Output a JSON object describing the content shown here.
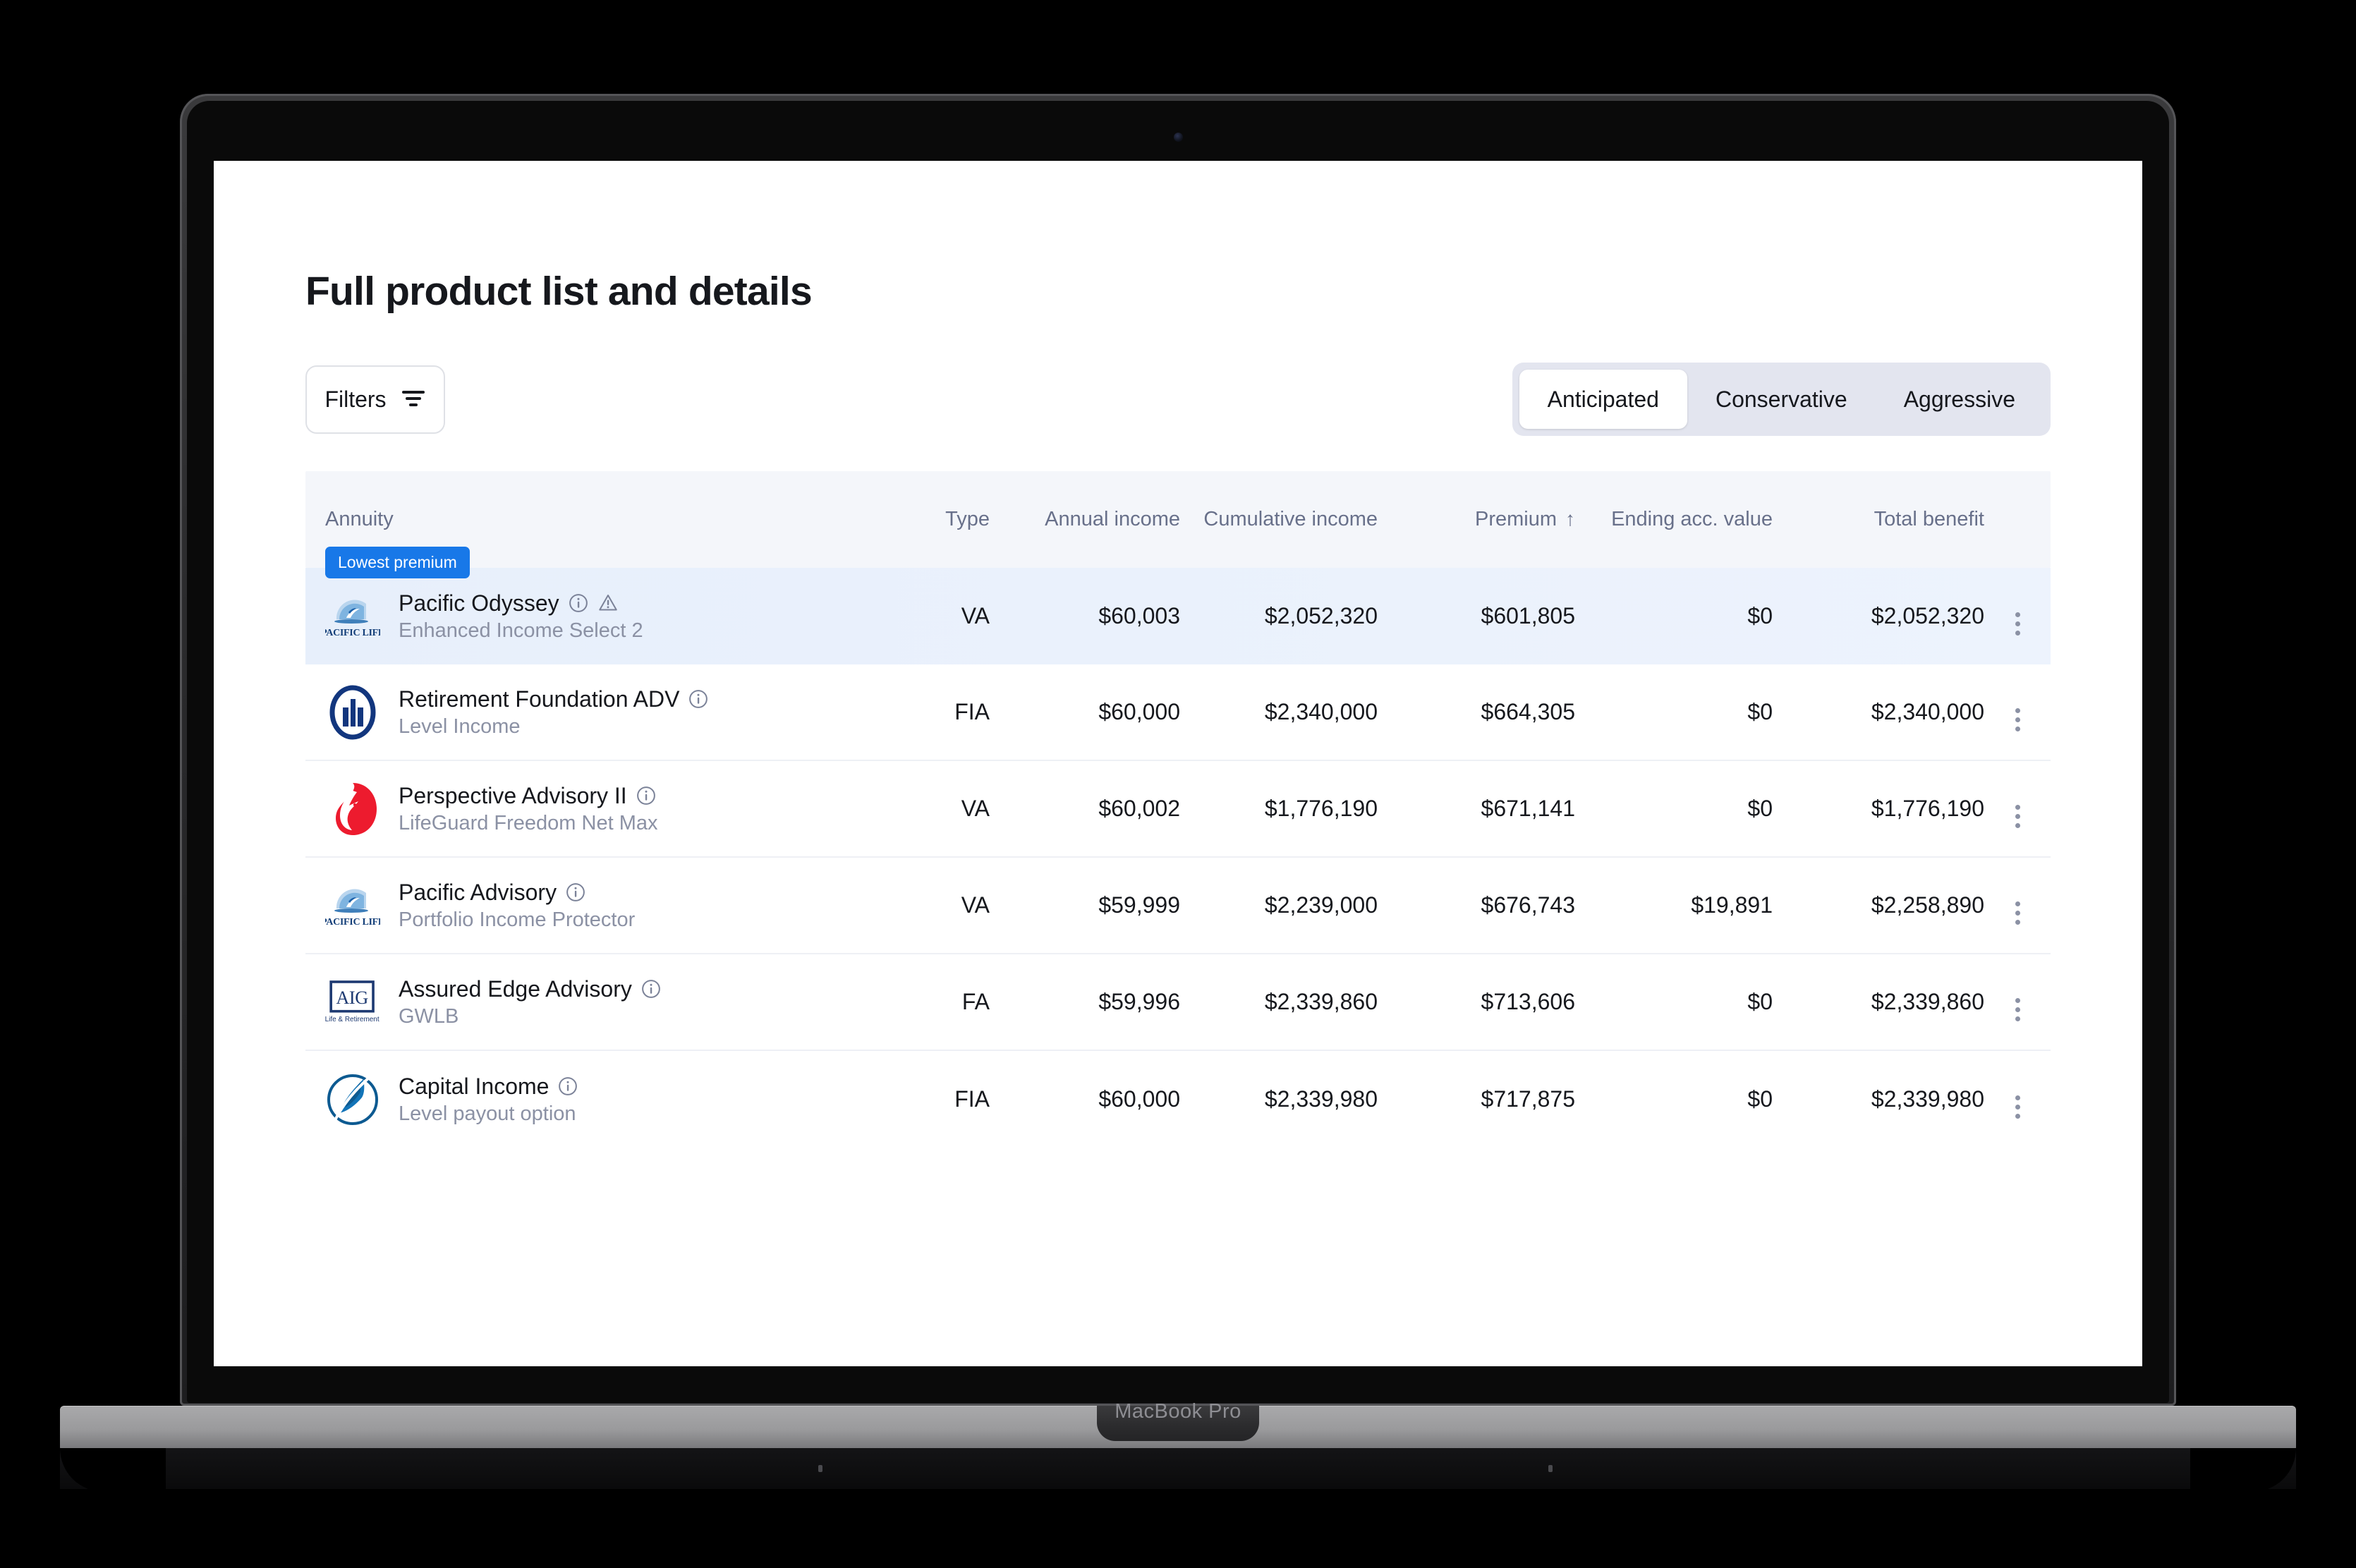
{
  "device": {
    "label": "MacBook Pro"
  },
  "page": {
    "title": "Full product list and details"
  },
  "toolbar": {
    "filters_label": "Filters",
    "filters_icon": "filter-icon",
    "scenarios": [
      {
        "label": "Anticipated",
        "active": true
      },
      {
        "label": "Conservative",
        "active": false
      },
      {
        "label": "Aggressive",
        "active": false
      }
    ]
  },
  "table": {
    "columns": [
      {
        "key": "annuity",
        "label": "Annuity"
      },
      {
        "key": "type",
        "label": "Type"
      },
      {
        "key": "annual_income",
        "label": "Annual income"
      },
      {
        "key": "cumulative_income",
        "label": "Cumulative income"
      },
      {
        "key": "premium",
        "label": "Premium",
        "sorted": true,
        "sort_dir": "asc",
        "sort_glyph": "↑"
      },
      {
        "key": "ending_acc_value",
        "label": "Ending acc. value"
      },
      {
        "key": "total_benefit",
        "label": "Total benefit"
      }
    ],
    "rows": [
      {
        "badge": "Lowest premium",
        "highlight": true,
        "logo": "pacific-life-logo",
        "name": "Pacific Odyssey",
        "subtitle": "Enhanced Income Select 2",
        "has_info": true,
        "has_warning": true,
        "type": "VA",
        "annual_income": "$60,003",
        "cumulative_income": "$2,052,320",
        "premium": "$601,805",
        "ending_acc_value": "$0",
        "total_benefit": "$2,052,320"
      },
      {
        "badge": null,
        "highlight": false,
        "logo": "allianz-logo",
        "name": "Retirement Foundation ADV",
        "subtitle": "Level Income",
        "has_info": true,
        "has_warning": false,
        "type": "FIA",
        "annual_income": "$60,000",
        "cumulative_income": "$2,340,000",
        "premium": "$664,305",
        "ending_acc_value": "$0",
        "total_benefit": "$2,340,000"
      },
      {
        "badge": null,
        "highlight": false,
        "logo": "prudential-logo",
        "name": "Perspective Advisory II",
        "subtitle": "LifeGuard Freedom Net Max",
        "has_info": true,
        "has_warning": false,
        "type": "VA",
        "annual_income": "$60,002",
        "cumulative_income": "$1,776,190",
        "premium": "$671,141",
        "ending_acc_value": "$0",
        "total_benefit": "$1,776,190"
      },
      {
        "badge": null,
        "highlight": false,
        "logo": "pacific-life-logo",
        "name": "Pacific Advisory",
        "subtitle": "Portfolio Income Protector",
        "has_info": true,
        "has_warning": false,
        "type": "VA",
        "annual_income": "$59,999",
        "cumulative_income": "$2,239,000",
        "premium": "$676,743",
        "ending_acc_value": "$19,891",
        "total_benefit": "$2,258,890"
      },
      {
        "badge": null,
        "highlight": false,
        "logo": "aig-logo",
        "name": "Assured Edge Advisory",
        "subtitle": "GWLB",
        "has_info": true,
        "has_warning": false,
        "type": "FA",
        "annual_income": "$59,996",
        "cumulative_income": "$2,339,860",
        "premium": "$713,606",
        "ending_acc_value": "$0",
        "total_benefit": "$2,339,860"
      },
      {
        "badge": null,
        "highlight": false,
        "logo": "nationwide-logo",
        "name": "Capital Income",
        "subtitle": "Level payout option",
        "has_info": true,
        "has_warning": false,
        "type": "FIA",
        "annual_income": "$60,000",
        "cumulative_income": "$2,339,980",
        "premium": "$717,875",
        "ending_acc_value": "$0",
        "total_benefit": "$2,339,980"
      }
    ]
  },
  "logos": {
    "pacific_life_text": "PACIFIC LIFE",
    "aig_text": "AIG",
    "aig_subtext": "Life & Retirement"
  },
  "colors": {
    "badge_blue": "#1878e8",
    "header_bg": "#f4f6fa",
    "header_text": "#68708a",
    "row_highlight": "#e7effb",
    "segmented_bg": "#e3e5ef",
    "allianz_navy": "#12367e",
    "prudential_red": "#ed1b2e",
    "aig_navy": "#1e3a72",
    "nationwide_blue": "#1274b8"
  }
}
